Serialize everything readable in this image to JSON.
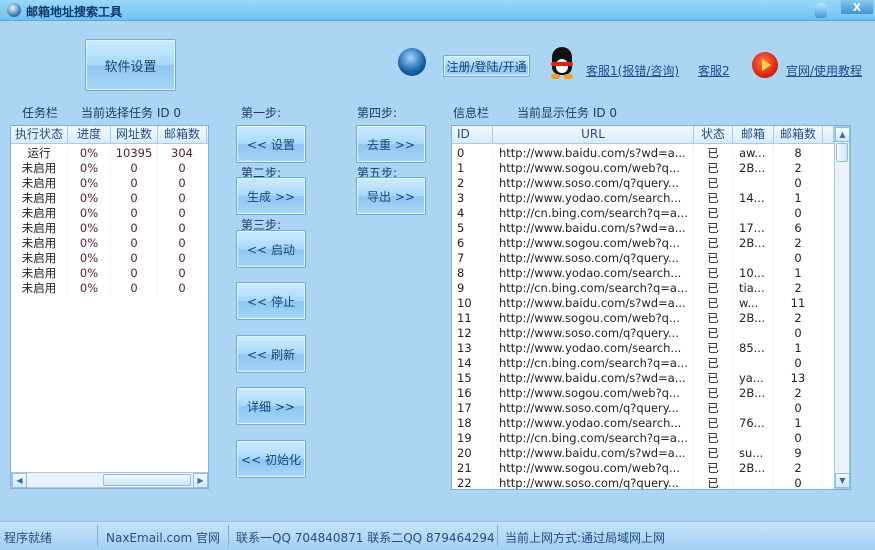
{
  "window": {
    "title": "邮箱地址搜索工具",
    "close_label": "X"
  },
  "toolbar": {
    "settings": "软件设置",
    "register": "注册/登陆/开通",
    "support1": "客服1(报错/咨询)",
    "support2": "客服2",
    "website": "官网/使用教程"
  },
  "tasks": {
    "label": "任务栏",
    "current": "当前选择任务 ID 0",
    "columns": [
      "执行状态",
      "进度",
      "网址数",
      "邮箱数"
    ],
    "rows": [
      [
        "运行",
        "0%",
        "10395",
        "304"
      ],
      [
        "未启用",
        "0%",
        "0",
        "0"
      ],
      [
        "未启用",
        "0%",
        "0",
        "0"
      ],
      [
        "未启用",
        "0%",
        "0",
        "0"
      ],
      [
        "未启用",
        "0%",
        "0",
        "0"
      ],
      [
        "未启用",
        "0%",
        "0",
        "0"
      ],
      [
        "未启用",
        "0%",
        "0",
        "0"
      ],
      [
        "未启用",
        "0%",
        "0",
        "0"
      ],
      [
        "未启用",
        "0%",
        "0",
        "0"
      ],
      [
        "未启用",
        "0%",
        "0",
        "0"
      ]
    ]
  },
  "steps": {
    "step1": "第一步:",
    "step2": "第二步:",
    "step3": "第三步:",
    "step4": "第四步:",
    "step5": "第五步:",
    "settings": "<< 设置",
    "generate": "生成 >>",
    "start": "<< 启动",
    "stop": "<< 停止",
    "refresh": "<< 刷新",
    "detail": "详细 >>",
    "init": "<< 初始化",
    "dedupe": "去重 >>",
    "export": "导出 >>"
  },
  "info": {
    "label": "信息栏",
    "current": "当前显示任务 ID 0",
    "columns": [
      "ID",
      "URL",
      "状态",
      "邮箱",
      "邮箱数"
    ],
    "rows": [
      [
        "0",
        "http://www.baidu.com/s?wd=a...",
        "已",
        "aw...",
        "8"
      ],
      [
        "1",
        "http://www.sogou.com/web?q...",
        "已",
        "2B...",
        "2"
      ],
      [
        "2",
        "http://www.soso.com/q?query...",
        "已",
        "",
        "0"
      ],
      [
        "3",
        "http://www.yodao.com/search...",
        "已",
        "14...",
        "1"
      ],
      [
        "4",
        "http://cn.bing.com/search?q=a...",
        "已",
        "",
        "0"
      ],
      [
        "5",
        "http://www.baidu.com/s?wd=a...",
        "已",
        "17...",
        "6"
      ],
      [
        "6",
        "http://www.sogou.com/web?q...",
        "已",
        "2B...",
        "2"
      ],
      [
        "7",
        "http://www.soso.com/q?query...",
        "已",
        "",
        "0"
      ],
      [
        "8",
        "http://www.yodao.com/search...",
        "已",
        "10...",
        "1"
      ],
      [
        "9",
        "http://cn.bing.com/search?q=a...",
        "已",
        "tia...",
        "2"
      ],
      [
        "10",
        "http://www.baidu.com/s?wd=a...",
        "已",
        "w...",
        "11"
      ],
      [
        "11",
        "http://www.sogou.com/web?q...",
        "已",
        "2B...",
        "2"
      ],
      [
        "12",
        "http://www.soso.com/q?query...",
        "已",
        "",
        "0"
      ],
      [
        "13",
        "http://www.yodao.com/search...",
        "已",
        "85...",
        "1"
      ],
      [
        "14",
        "http://cn.bing.com/search?q=a...",
        "已",
        "",
        "0"
      ],
      [
        "15",
        "http://www.baidu.com/s?wd=a...",
        "已",
        "ya...",
        "13"
      ],
      [
        "16",
        "http://www.sogou.com/web?q...",
        "已",
        "2B...",
        "2"
      ],
      [
        "17",
        "http://www.soso.com/q?query...",
        "已",
        "",
        "0"
      ],
      [
        "18",
        "http://www.yodao.com/search...",
        "已",
        "76...",
        "1"
      ],
      [
        "19",
        "http://cn.bing.com/search?q=a...",
        "已",
        "",
        "0"
      ],
      [
        "20",
        "http://www.baidu.com/s?wd=a...",
        "已",
        "su...",
        "9"
      ],
      [
        "21",
        "http://www.sogou.com/web?q...",
        "已",
        "2B...",
        "2"
      ],
      [
        "22",
        "http://www.soso.com/q?query...",
        "已",
        "",
        "0"
      ]
    ]
  },
  "status": {
    "ready": "程序就绪",
    "site": "NaxEmail.com 官网",
    "contact": "联系一QQ 704840871 联系二QQ 879464294",
    "network": "当前上网方式:通过局域网上网"
  }
}
